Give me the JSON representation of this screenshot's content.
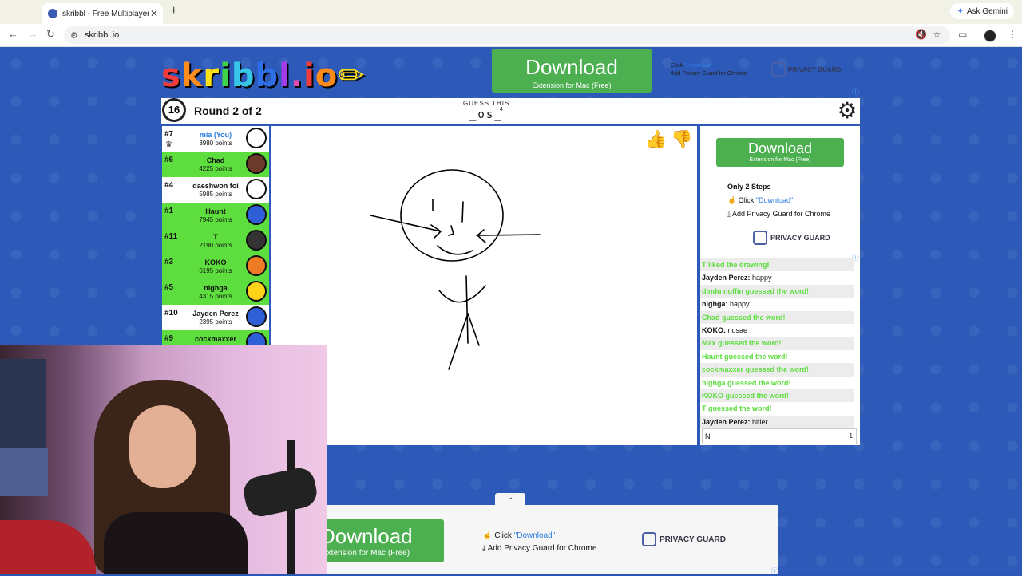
{
  "browser": {
    "tab_title": "skribbl - Free Multiplayer Dra",
    "url": "skribbl.io",
    "ask_gemini": "Ask Gemini"
  },
  "logo": {
    "text": "skribbl.io"
  },
  "ad_top": {
    "download": "Download",
    "sub": "Extension for Mac (Free)",
    "step1_prefix": "Click",
    "step1_link": "\"Download\"",
    "step2": "Add Privacy Guard for Chrome",
    "brand": "PRIVACY GUARD"
  },
  "game": {
    "timer": "16",
    "round": "Round 2 of 2",
    "guess_label": "GUESS THIS",
    "word_hint": "_os_",
    "word_length": "4"
  },
  "players": [
    {
      "rank": "#7",
      "name": "mia (You)",
      "points": "3980 points",
      "you": true,
      "color": "#ffffff"
    },
    {
      "rank": "#6",
      "name": "Chad",
      "points": "4225 points",
      "you": false,
      "color": "#6b3a2a"
    },
    {
      "rank": "#4",
      "name": "daeshwon foi",
      "points": "5985 points",
      "you": false,
      "color": "#ffffff"
    },
    {
      "rank": "#1",
      "name": "Haunt",
      "points": "7945 points",
      "you": false,
      "color": "#2e5fd6"
    },
    {
      "rank": "#11",
      "name": "T",
      "points": "2190 points",
      "you": false,
      "color": "#333333"
    },
    {
      "rank": "#3",
      "name": "KOKO",
      "points": "6195 points",
      "you": false,
      "color": "#ef7b25"
    },
    {
      "rank": "#5",
      "name": "nighga",
      "points": "4315 points",
      "you": false,
      "color": "#ffd21a"
    },
    {
      "rank": "#10",
      "name": "Jayden Perez",
      "points": "2395 points",
      "you": false,
      "color": "#2e5fd6"
    },
    {
      "rank": "#9",
      "name": "cockmaxxer",
      "points": "",
      "you": false,
      "color": "#2e5fd6"
    }
  ],
  "ad_right": {
    "download": "Download",
    "sub": "Extension for Mac (Free)",
    "only_steps": "Only 2 Steps",
    "step1_prefix": "Click",
    "step1_link": "\"Download\"",
    "step2": "Add Privacy Guard for Chrome",
    "brand": "PRIVACY GUARD"
  },
  "chat": [
    {
      "type": "system",
      "text": "T liked the drawing!"
    },
    {
      "type": "user",
      "user": "Jayden Perez:",
      "text": " happy"
    },
    {
      "type": "system",
      "text": "dindu nuffin guessed the word!"
    },
    {
      "type": "user",
      "user": "nighga:",
      "text": " happy"
    },
    {
      "type": "system",
      "text": "Chad guessed the word!"
    },
    {
      "type": "user",
      "user": "KOKO:",
      "text": " nosae"
    },
    {
      "type": "system",
      "text": "Max guessed the word!"
    },
    {
      "type": "system",
      "text": "Haunt guessed the word!"
    },
    {
      "type": "system",
      "text": "cockmaxxer guessed the word!"
    },
    {
      "type": "system",
      "text": "nighga guessed the word!"
    },
    {
      "type": "system",
      "text": "KOKO guessed the word!"
    },
    {
      "type": "system",
      "text": "T guessed the word!"
    },
    {
      "type": "user",
      "user": "Jayden Perez:",
      "text": " hitler"
    }
  ],
  "chat_input": {
    "value": "N",
    "count": "1"
  },
  "ad_bottom": {
    "download": "Download",
    "sub": "Extension for Mac (Free)",
    "step1_prefix": "Click",
    "step1_link": "\"Download\"",
    "step2": "Add Privacy Guard for Chrome",
    "brand": "PRIVACY GUARD"
  }
}
